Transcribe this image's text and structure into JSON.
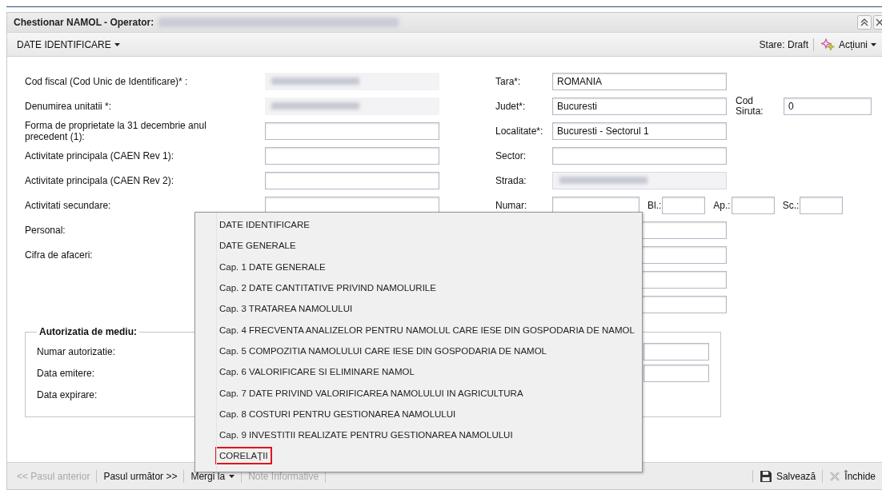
{
  "window": {
    "title": "Chestionar NAMOL - Operator:",
    "operator_obscured": true,
    "buttons": [
      {
        "kind": "collapse"
      },
      {
        "kind": "close"
      }
    ]
  },
  "toolbar": {
    "section_menu": "DATE IDENTIFICARE",
    "status": "Stare: Draft",
    "actions": "Acțiuni"
  },
  "form": {
    "left": [
      {
        "label": "Cod fiscal (Cod Unic de Identificare)* :",
        "kind": "obscured"
      },
      {
        "label": "Denumirea unitatii *:",
        "kind": "obscured"
      },
      {
        "label": "Forma de proprietate la 31 decembrie anul precedent (1):",
        "kind": "field"
      },
      {
        "label": "Activitate principala (CAEN Rev 1):",
        "kind": "field"
      },
      {
        "label": "Activitate principala (CAEN Rev 2):",
        "kind": "field"
      },
      {
        "label": "Activitati secundare:",
        "kind": "field"
      },
      {
        "label": "Personal:",
        "kind": "label_only"
      },
      {
        "label": "Cifra de afaceri:",
        "kind": "label_only"
      }
    ],
    "right": [
      {
        "kind": "field",
        "label": "Tara*:",
        "value": "ROMANIA"
      },
      {
        "kind": "field",
        "label": "Judet*:",
        "value": "Bucuresti",
        "extra": {
          "label": "Cod Siruta:",
          "value": "0"
        }
      },
      {
        "kind": "field",
        "label": "Localitate*:",
        "value": "Bucuresti - Sectorul 1"
      },
      {
        "kind": "field",
        "label": "Sector:"
      },
      {
        "kind": "obscured",
        "label": "Strada:"
      },
      {
        "kind": "number",
        "label": "Numar:",
        "parts": [
          {
            "label": "Bl.:"
          },
          {
            "label": "Ap.:"
          },
          {
            "label": "Sc.:"
          }
        ]
      },
      {
        "kind": "field"
      },
      {
        "kind": "field"
      },
      {
        "kind": "field"
      },
      {
        "kind": "field"
      }
    ]
  },
  "authorization": {
    "legend": "Autorizatia de mediu:",
    "rows": [
      {
        "label": "Numar autorizatie:",
        "kind": "field"
      },
      {
        "label": "Data emitere:",
        "kind": "field"
      },
      {
        "label": "Data expirare:",
        "kind": "label_only"
      }
    ]
  },
  "menu": {
    "items": [
      {
        "label": "DATE IDENTIFICARE",
        "selected": false
      },
      {
        "label": "DATE GENERALE",
        "selected": false
      },
      {
        "label": "Cap. 1 DATE GENERALE",
        "selected": false
      },
      {
        "label": "Cap. 2 DATE CANTITATIVE PRIVIND NAMOLURILE",
        "selected": false
      },
      {
        "label": "Cap. 3 TRATAREA NAMOLULUI",
        "selected": false
      },
      {
        "label": "Cap. 4 FRECVENTA ANALIZELOR PENTRU NAMOLUL CARE IESE DIN GOSPODARIA DE NAMOL",
        "selected": false
      },
      {
        "label": "Cap. 5 COMPOZITIA NAMOLULUI CARE IESE DIN GOSPODARIA DE NAMOL",
        "selected": false
      },
      {
        "label": "Cap. 6 VALORIFICARE SI ELIMINARE NAMOL",
        "selected": false
      },
      {
        "label": "Cap. 7 DATE PRIVIND VALORIFICAREA NAMOLULUI IN AGRICULTURA",
        "selected": false
      },
      {
        "label": "Cap. 8 COSTURI PENTRU GESTIONAREA NAMOLULUI",
        "selected": false
      },
      {
        "label": "Cap. 9 INVESTITII REALIZATE PENTRU GESTIONAREA NAMOLULUI",
        "selected": false
      },
      {
        "label": "CORELAŢII",
        "selected": true
      }
    ]
  },
  "bottom_bar": {
    "left": [
      {
        "label": "<< Pasul anterior",
        "disabled": true,
        "kind": "button"
      },
      {
        "label": "Pasul următor >>",
        "disabled": false,
        "kind": "button"
      },
      {
        "label": "Mergi la",
        "disabled": false,
        "kind": "menu"
      },
      {
        "label": "Note Informative",
        "disabled": true,
        "kind": "button"
      }
    ],
    "right": [
      {
        "label": "Salvează",
        "kind": "save",
        "disabled": false
      },
      {
        "label": "Închide",
        "kind": "close",
        "disabled": false
      }
    ]
  }
}
